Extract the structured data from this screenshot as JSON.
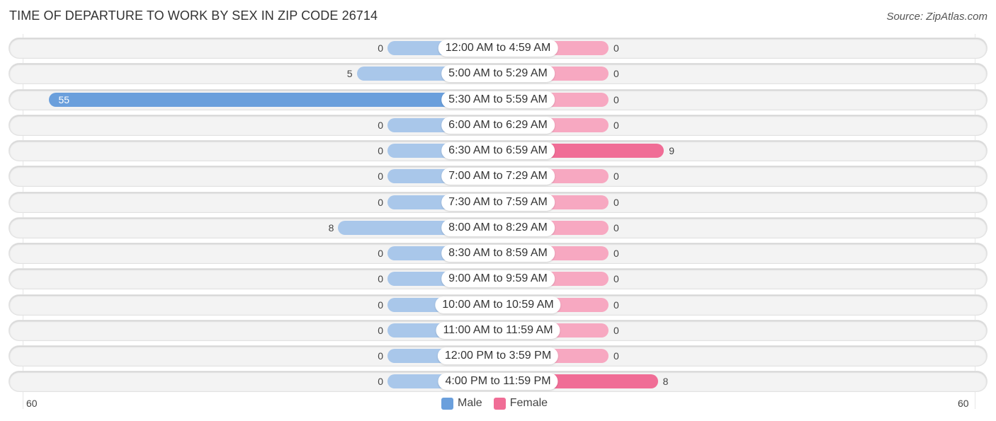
{
  "title": "TIME OF DEPARTURE TO WORK BY SEX IN ZIP CODE 26714",
  "source": "Source: ZipAtlas.com",
  "colors": {
    "male": "#a9c7ea",
    "male_strong": "#6a9fdc",
    "female": "#f7a8c1",
    "female_strong": "#f06d96"
  },
  "chart_data": {
    "type": "bar",
    "orientation": "horizontal-diverging",
    "title": "TIME OF DEPARTURE TO WORK BY SEX IN ZIP CODE 26714",
    "categories": [
      "12:00 AM to 4:59 AM",
      "5:00 AM to 5:29 AM",
      "5:30 AM to 5:59 AM",
      "6:00 AM to 6:29 AM",
      "6:30 AM to 6:59 AM",
      "7:00 AM to 7:29 AM",
      "7:30 AM to 7:59 AM",
      "8:00 AM to 8:29 AM",
      "8:30 AM to 8:59 AM",
      "9:00 AM to 9:59 AM",
      "10:00 AM to 10:59 AM",
      "11:00 AM to 11:59 AM",
      "12:00 PM to 3:59 PM",
      "4:00 PM to 11:59 PM"
    ],
    "series": [
      {
        "name": "Male",
        "values": [
          0,
          5,
          55,
          0,
          0,
          0,
          0,
          8,
          0,
          0,
          0,
          0,
          0,
          0
        ]
      },
      {
        "name": "Female",
        "values": [
          0,
          0,
          0,
          0,
          9,
          0,
          0,
          0,
          0,
          0,
          0,
          0,
          0,
          8
        ]
      }
    ],
    "xlim": [
      -60,
      60
    ],
    "axis_tick_labels": {
      "left": "60",
      "right": "60"
    },
    "legend": {
      "position": "bottom-center",
      "entries": [
        "Male",
        "Female"
      ]
    }
  }
}
